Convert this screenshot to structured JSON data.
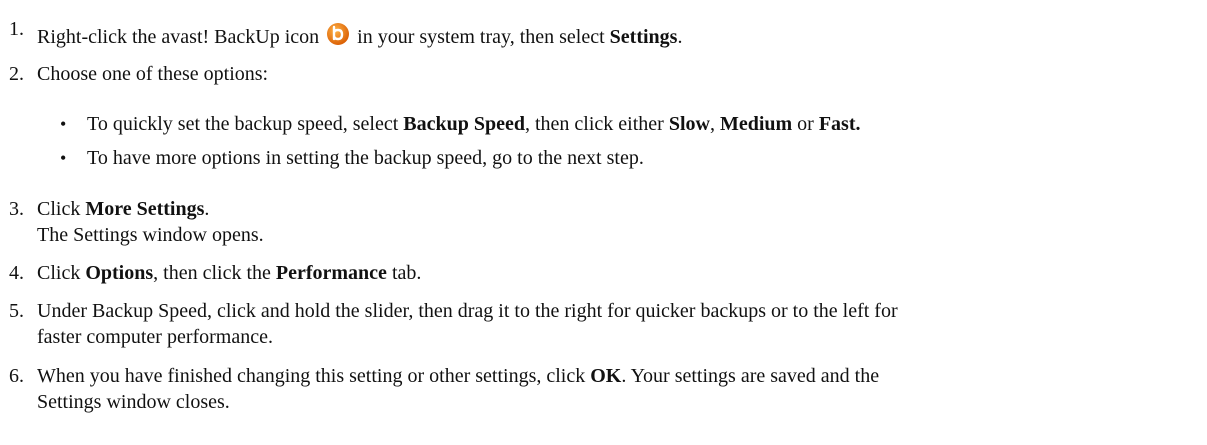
{
  "steps": [
    {
      "num": "1.",
      "parts": [
        "Right-click the avast! BackUp icon",
        "in your system tray, then select",
        "Settings",
        "."
      ]
    },
    {
      "num": "2.",
      "parts": [
        "Choose one of these options:"
      ]
    },
    {
      "num": "3.",
      "parts": [
        "Click",
        "More Settings",
        ".",
        "The Settings window opens."
      ]
    },
    {
      "num": "4.",
      "parts": [
        "Click",
        "Options",
        ", then click the",
        "Performance",
        "tab."
      ]
    },
    {
      "num": "5.",
      "parts": [
        "Under Backup Speed, click and hold the slider, then drag it to the right for quicker backups or to the left for",
        "faster computer performance."
      ]
    },
    {
      "num": "6.",
      "parts": [
        "When you have finished changing this setting or other settings, click",
        "OK",
        ". Your settings are saved and the",
        "Settings window closes."
      ]
    }
  ],
  "bullets": [
    {
      "glyph": "•",
      "parts": [
        "To quickly set the backup speed, select",
        "Backup Speed",
        ", then click either",
        "Slow",
        ",",
        "Medium",
        "or",
        "Fast."
      ]
    },
    {
      "glyph": "•",
      "parts": [
        "To have more options in setting the backup speed, go to the next step."
      ]
    }
  ],
  "icons": {
    "tray": "avast-backup-icon",
    "tray_color": "#e8790c"
  }
}
